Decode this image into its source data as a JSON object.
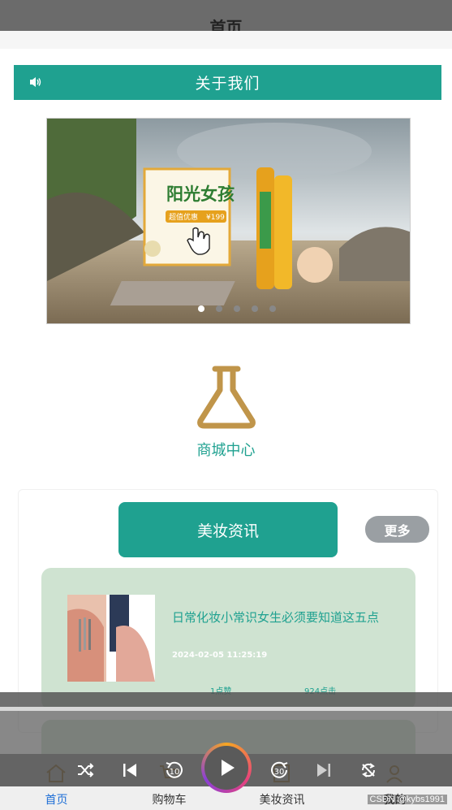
{
  "header": {
    "title": "首页"
  },
  "about": {
    "label": "关于我们"
  },
  "banner": {
    "headline": "阳光女孩",
    "sub_tag": "超值优惠",
    "price_tag": "¥199",
    "dots": 5,
    "active_dot": 0
  },
  "mall": {
    "label": "商城中心",
    "icon": "flask-icon"
  },
  "news": {
    "title": "美妆资讯",
    "more_label": "更多",
    "items": [
      {
        "title": "日常化妆小常识女生必须要知道这五点",
        "date": "2024-02-05 11:25:19",
        "likes": "1点赞",
        "clicks": "924点击"
      }
    ]
  },
  "tabs": [
    {
      "label": "首页",
      "icon": "home-icon",
      "active": true
    },
    {
      "label": "购物车",
      "icon": "cart-icon",
      "active": false
    },
    {
      "label": "美妆资讯",
      "icon": "news-icon",
      "active": false
    },
    {
      "label": "我的",
      "icon": "user-icon",
      "active": false
    }
  ],
  "player": {
    "controls": [
      "shuffle-icon",
      "previous-icon",
      "rewind-10-icon",
      "play-icon",
      "forward-30-icon",
      "next-icon",
      "repeat-icon"
    ],
    "rewind_label": "10",
    "forward_label": "30"
  },
  "watermark": "CSDN @kybs1991",
  "colors": {
    "accent": "#1fa190",
    "card_bg": "#cfe3d1",
    "more_bg": "#9a9fa3",
    "flask": "#c0954a"
  }
}
